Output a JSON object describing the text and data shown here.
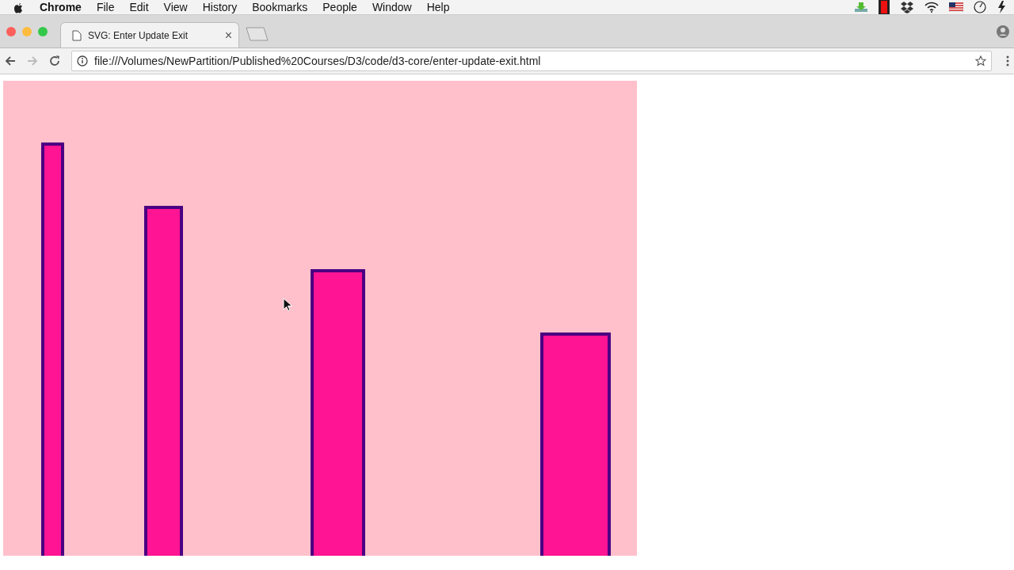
{
  "menu_bar": {
    "app": "Chrome",
    "items": [
      "File",
      "Edit",
      "View",
      "History",
      "Bookmarks",
      "People",
      "Window",
      "Help"
    ]
  },
  "tab": {
    "title": "SVG: Enter Update Exit",
    "close": "×"
  },
  "address_bar": {
    "url": "file:///Volumes/NewPartition/Published%20Courses/D3/code/d3-core/enter-update-exit.html"
  }
}
